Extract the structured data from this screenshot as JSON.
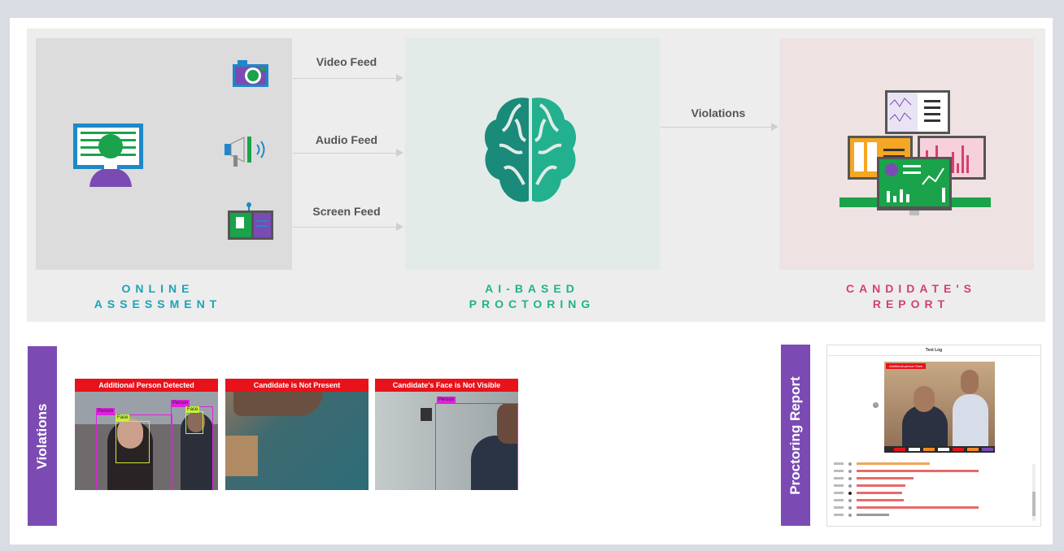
{
  "flow": {
    "feeds": [
      {
        "label": "Video Feed",
        "icon": "camera-icon"
      },
      {
        "label": "Audio Feed",
        "icon": "megaphone-icon"
      },
      {
        "label": "Screen Feed",
        "icon": "screen-icon"
      }
    ],
    "violations_label": "Violations",
    "captions": {
      "online": "ONLINE\nASSESSMENT",
      "ai": "AI-BASED\nPROCTORING",
      "report": "CANDIDATE'S\nREPORT"
    },
    "caption_colors": {
      "online": "#1aa3b8",
      "ai": "#1fb38a",
      "report": "#d4406f"
    }
  },
  "violations": {
    "tab_label": "Violations",
    "snapshots": [
      {
        "title": "Additional Person Detected",
        "tags": [
          "Person",
          "Face",
          "Person",
          "Face"
        ]
      },
      {
        "title": "Candidate is Not Present"
      },
      {
        "title": "Candidate's Face is Not Visible",
        "tags": [
          "Person"
        ]
      }
    ]
  },
  "report": {
    "tab_label": "Proctoring Report",
    "window_title": "Test Log",
    "image_caption": "Additional person Seen"
  },
  "colors": {
    "accent": "#7b4bb3",
    "alert": "#e8121b",
    "green": "#1aa34a"
  }
}
